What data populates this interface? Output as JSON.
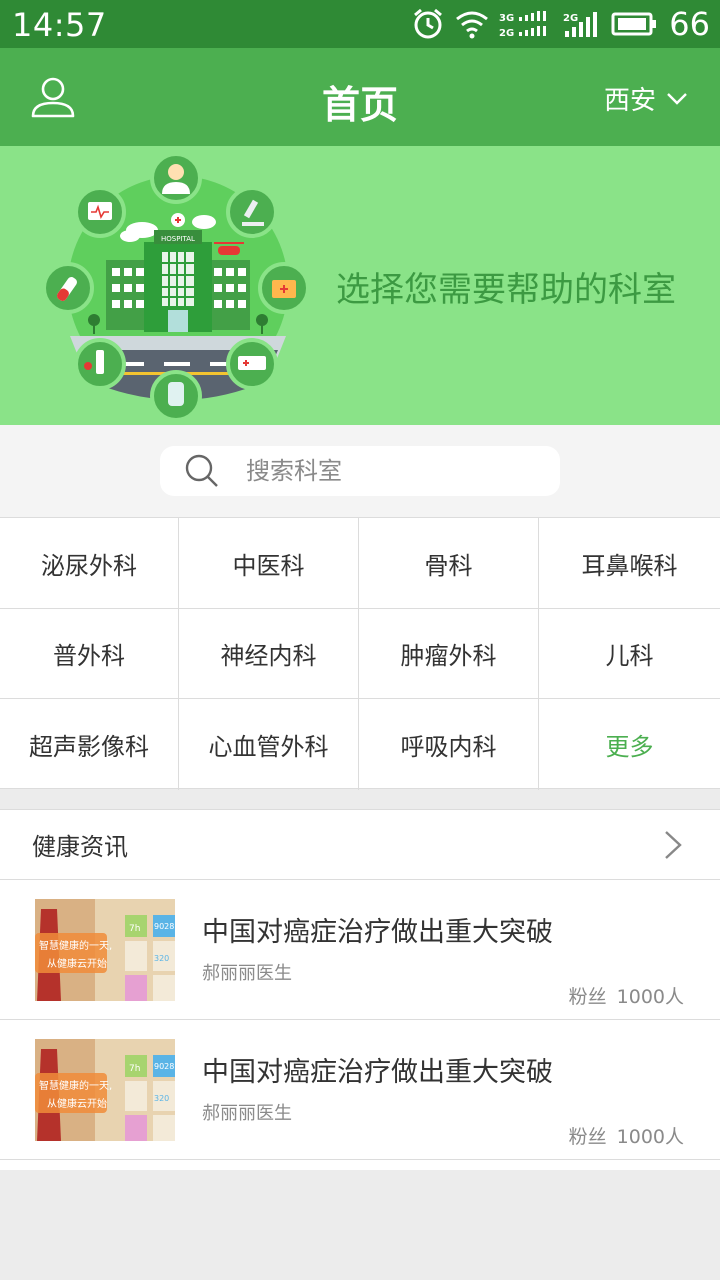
{
  "status_bar": {
    "time": "14:57",
    "signal_labels": [
      "3G",
      "2G",
      "2G"
    ],
    "battery_level": "66"
  },
  "app_bar": {
    "title": "首页",
    "city": "西安",
    "icons": {
      "left": "user-icon",
      "right": "chevron-down-icon"
    }
  },
  "banner": {
    "text": "选择您需要帮助的科室",
    "hospital_sign": "HOSPITAL"
  },
  "search": {
    "placeholder": "搜索科室",
    "value": ""
  },
  "departments": [
    {
      "label": "泌尿外科"
    },
    {
      "label": "中医科"
    },
    {
      "label": "骨科"
    },
    {
      "label": "耳鼻喉科"
    },
    {
      "label": "普外科"
    },
    {
      "label": "神经内科"
    },
    {
      "label": "肿瘤外科"
    },
    {
      "label": "儿科"
    },
    {
      "label": "超声影像科"
    },
    {
      "label": "心血管外科"
    },
    {
      "label": "呼吸内科"
    },
    {
      "label": "更多"
    }
  ],
  "news": {
    "header": "健康资讯",
    "items": [
      {
        "title": "中国对癌症治疗做出重大突破",
        "author": "郝丽丽医生",
        "fans_label": "粉丝",
        "fans_count": "1000人",
        "thumb_lines": [
          "智慧健康的一天,",
          "从健康云开始"
        ],
        "thumb_stats": [
          "7h",
          "9028",
          "320"
        ]
      },
      {
        "title": "中国对癌症治疗做出重大突破",
        "author": "郝丽丽医生",
        "fans_label": "粉丝",
        "fans_count": "1000人",
        "thumb_lines": [
          "智慧健康的一天,",
          "从健康云开始"
        ],
        "thumb_stats": [
          "7h",
          "9028",
          "320"
        ]
      }
    ]
  },
  "colors": {
    "status_bar": "#2f8a35",
    "app_bar": "#4caf50",
    "banner": "#8ae388",
    "banner_text": "#3c9a42",
    "accent": "#4caf50"
  }
}
